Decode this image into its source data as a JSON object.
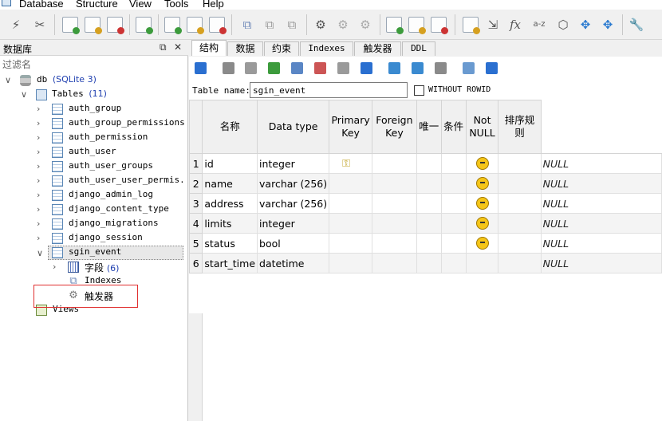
{
  "menu": [
    "Database",
    "Structure",
    "View",
    "Tools",
    "Help"
  ],
  "left_panel": {
    "title": "数据库",
    "filter_placeholder": "过滤名",
    "tree": {
      "db_name": "db",
      "db_type": "(SQLite 3)",
      "tables_label": "Tables",
      "tables_count": "(11)",
      "tables": [
        "auth_group",
        "auth_group_permissions",
        "auth_permission",
        "auth_user",
        "auth_user_groups",
        "auth_user_user_permis...",
        "django_admin_log",
        "django_content_type",
        "django_migrations",
        "django_session",
        "sgin_event"
      ],
      "selected_table": "sgin_event",
      "children": {
        "fields_label": "字段",
        "fields_count": "(6)",
        "indexes_label": "Indexes",
        "triggers_label": "触发器"
      },
      "views_label": "Views"
    }
  },
  "right_panel": {
    "tabs": [
      "结构",
      "数据",
      "约束",
      "Indexes",
      "触发器",
      "DDL"
    ],
    "active_tab": "结构",
    "table_name_label": "Table name:",
    "table_name": "sgin_event",
    "without_rowid_label": "WITHOUT ROWID",
    "columns": [
      "名称",
      "Data type",
      "Primary Key",
      "Foreign Key",
      "唯一",
      "条件",
      "Not NULL",
      "排序规则"
    ],
    "rows": [
      {
        "n": "1",
        "name": "id",
        "type": "integer",
        "pk": true,
        "notnull": true,
        "default": "NULL"
      },
      {
        "n": "2",
        "name": "name",
        "type": "varchar (256)",
        "pk": false,
        "notnull": true,
        "default": "NULL"
      },
      {
        "n": "3",
        "name": "address",
        "type": "varchar (256)",
        "pk": false,
        "notnull": true,
        "default": "NULL"
      },
      {
        "n": "4",
        "name": "limits",
        "type": "integer",
        "pk": false,
        "notnull": true,
        "default": "NULL"
      },
      {
        "n": "5",
        "name": "status",
        "type": "bool",
        "pk": false,
        "notnull": true,
        "default": "NULL"
      },
      {
        "n": "6",
        "name": "start_time",
        "type": "datetime",
        "pk": false,
        "notnull": false,
        "default": "NULL"
      }
    ]
  },
  "colors": {
    "accent_blue": "#2040b0",
    "selection_border": "#e03030"
  }
}
